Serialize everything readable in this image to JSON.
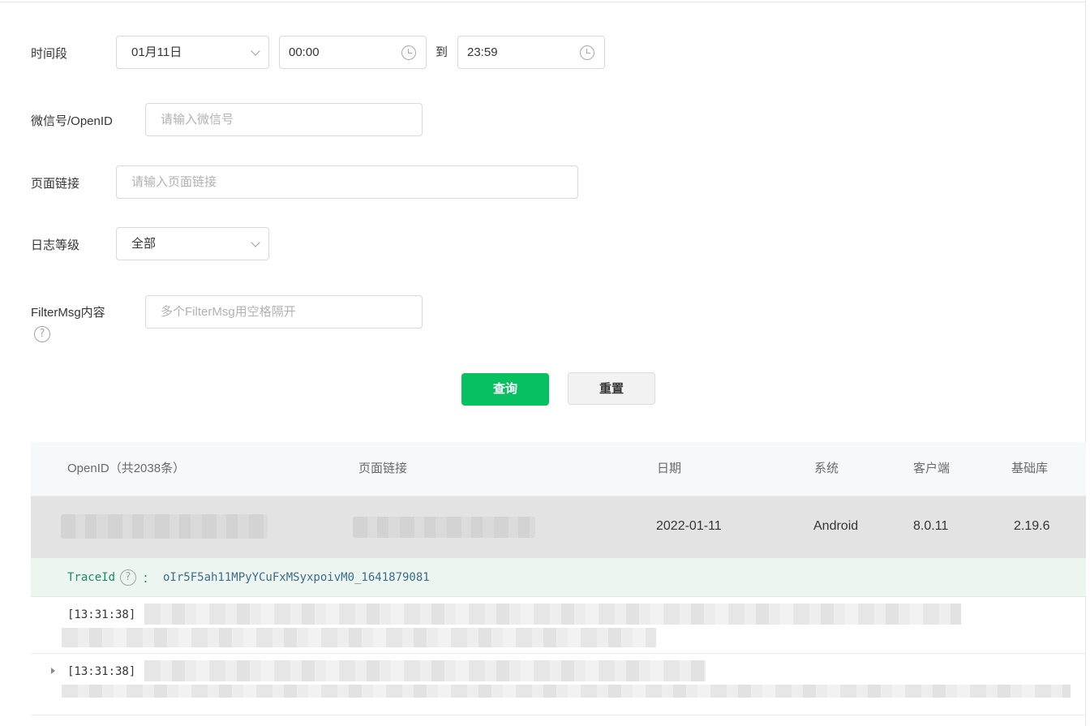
{
  "filters": {
    "time_range": {
      "label": "时间段",
      "date": "01月11日",
      "start_time": "00:00",
      "separator": "到",
      "end_time": "23:59"
    },
    "wechat_id": {
      "label": "微信号/OpenID",
      "placeholder": "请输入微信号",
      "value": ""
    },
    "page_link": {
      "label": "页面链接",
      "placeholder": "请输入页面链接",
      "value": ""
    },
    "log_level": {
      "label": "日志等级",
      "selected": "全部"
    },
    "filter_msg": {
      "label": "FilterMsg内容",
      "placeholder": "多个FilterMsg用空格隔开",
      "value": ""
    }
  },
  "actions": {
    "query": "查询",
    "reset": "重置"
  },
  "table": {
    "headers": [
      "OpenID（共2038条）",
      "页面链接",
      "日期",
      "系统",
      "客户端",
      "基础库"
    ],
    "rows": [
      {
        "date": "2022-01-11",
        "system": "Android",
        "client": "8.0.11",
        "base_lib": "2.19.6"
      }
    ]
  },
  "trace": {
    "key": "TraceId",
    "colon": "：",
    "value": "oIr5F5ah11MPyYCuFxMSyxpoivM0_1641879081"
  },
  "logs": [
    {
      "time": "[13:31:38]"
    },
    {
      "time": "[13:31:38]"
    }
  ],
  "icons": {
    "help": "question-circle-icon",
    "clock": "clock-icon",
    "dropdown": "chevron-down-icon",
    "expand": "caret-right-icon"
  },
  "colors": {
    "primary": "#07c160",
    "table_header_bg": "#f7f8fa",
    "selected_row_bg": "#e3e3e3",
    "trace_bg": "#edf5f0"
  }
}
